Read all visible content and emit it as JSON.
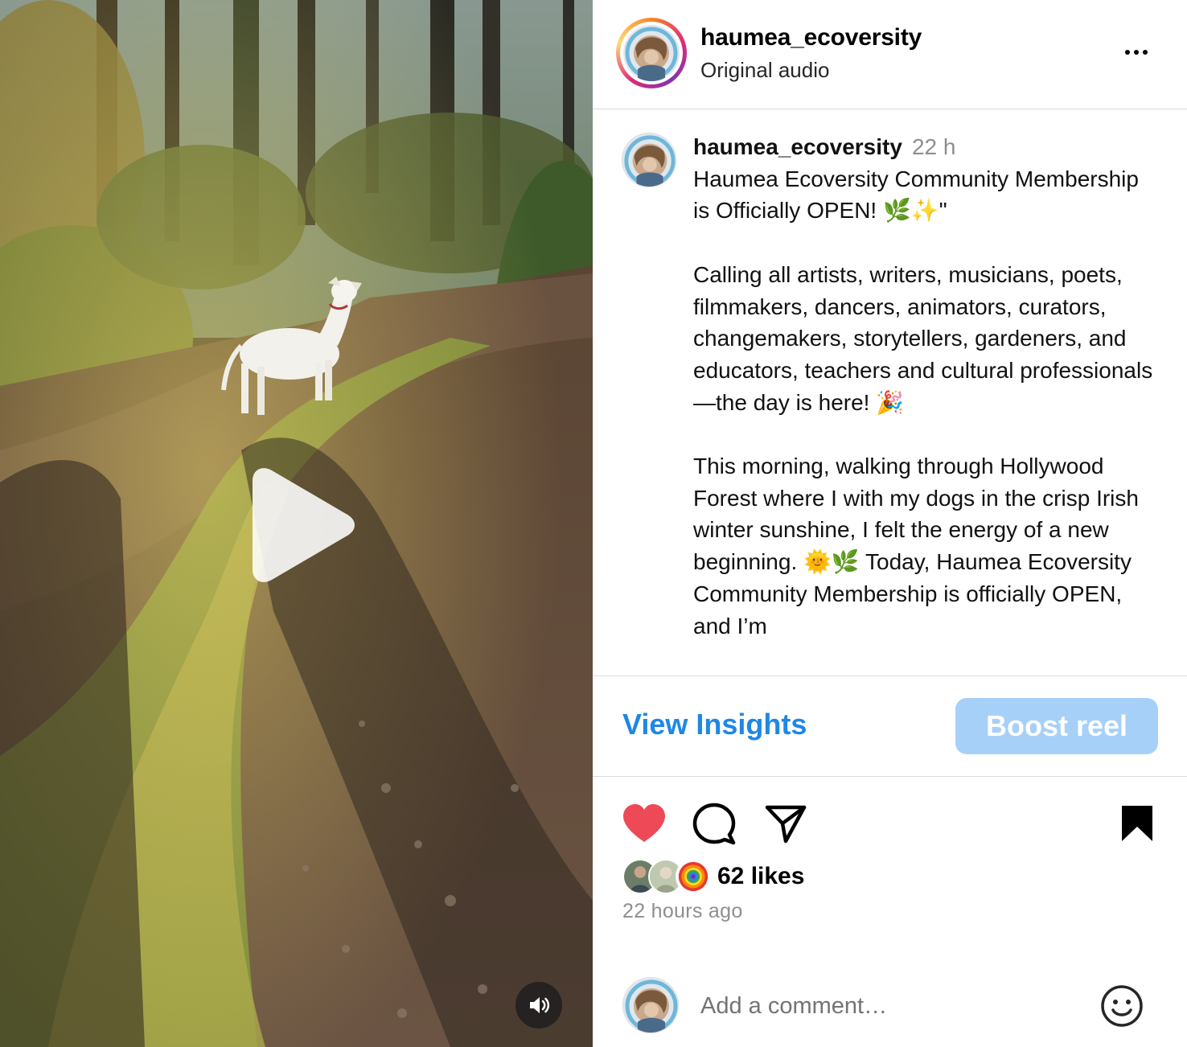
{
  "post": {
    "username": "haumea_ecoversity",
    "audio": "Original audio",
    "caption_username": "haumea_ecoversity",
    "caption_time": "22 h",
    "caption_paragraphs": [
      "Haumea Ecoversity Community Membership is Officially OPEN! 🌿✨\"",
      "Calling all artists, writers, musicians, poets, filmmakers, dancers, animators, curators, changemakers, storytellers, gardeners, and educators, teachers and cultural professionals —the day is here! 🎉",
      "This morning, walking through Hollywood Forest where I with my dogs in the crisp Irish winter sunshine, I felt the energy of a new beginning. 🌞🌿 Today, Haumea Ecoversity Community Membership is officially OPEN, and I’m"
    ]
  },
  "actions": {
    "view_insights": "View Insights",
    "boost": "Boost reel",
    "likes": "62 likes",
    "time_ago": "22 hours ago",
    "liked": true,
    "saved": true
  },
  "comment": {
    "placeholder": "Add a comment…"
  },
  "colors": {
    "link_blue": "#1e88e5",
    "boost_bg": "#a6d0f7",
    "like_red": "#ed4956",
    "muted_text": "#8e8e8e"
  },
  "icons": [
    "more-icon",
    "play-icon",
    "volume-icon",
    "heart-icon",
    "comment-icon",
    "share-icon",
    "bookmark-icon",
    "emoji-icon"
  ]
}
